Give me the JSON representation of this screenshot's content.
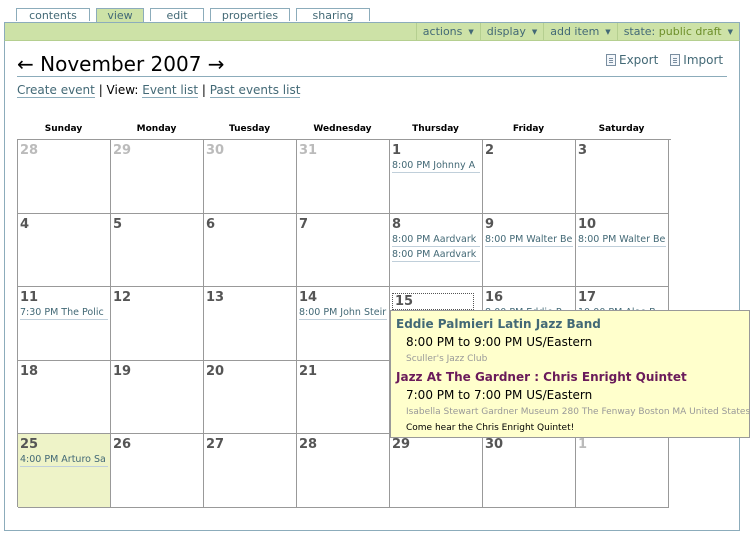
{
  "tabs": [
    {
      "label": "contents",
      "active": false
    },
    {
      "label": "view",
      "active": true
    },
    {
      "label": "edit",
      "active": false
    },
    {
      "label": "properties",
      "active": false
    },
    {
      "label": "sharing",
      "active": false
    }
  ],
  "menus": {
    "actions": "actions",
    "display": "display",
    "add_item": "add item",
    "state_label": "state:",
    "state_value": "public draft"
  },
  "header": {
    "prev_arrow": "←",
    "month": "November 2007",
    "next_arrow": "→",
    "export": "Export",
    "import": "Import"
  },
  "links": {
    "create_event": "Create event",
    "view_label": " | View: ",
    "event_list": "Event list",
    "sep": " | ",
    "past_events": "Past events list"
  },
  "weekdays": [
    "Sunday",
    "Monday",
    "Tuesday",
    "Wednesday",
    "Thursday",
    "Friday",
    "Saturday"
  ],
  "days": [
    {
      "num": "28",
      "other": true,
      "events": []
    },
    {
      "num": "29",
      "other": true,
      "events": []
    },
    {
      "num": "30",
      "other": true,
      "events": []
    },
    {
      "num": "31",
      "other": true,
      "events": []
    },
    {
      "num": "1",
      "events": [
        "8:00 PM Johnny A"
      ]
    },
    {
      "num": "2",
      "events": []
    },
    {
      "num": "3",
      "events": []
    },
    {
      "num": "4",
      "events": []
    },
    {
      "num": "5",
      "events": []
    },
    {
      "num": "6",
      "events": []
    },
    {
      "num": "7",
      "events": []
    },
    {
      "num": "8",
      "events": [
        "8:00 PM Aardvark",
        "8:00 PM Aardvark"
      ]
    },
    {
      "num": "9",
      "events": [
        "8:00 PM Walter Be"
      ]
    },
    {
      "num": "10",
      "events": [
        "8:00 PM Walter Be"
      ]
    },
    {
      "num": "11",
      "events": [
        "7:30 PM The Polic"
      ]
    },
    {
      "num": "12",
      "events": []
    },
    {
      "num": "13",
      "events": []
    },
    {
      "num": "14",
      "events": [
        "8:00 PM John Steir"
      ]
    },
    {
      "num": "15",
      "boxed": true,
      "events": [
        "8:00 PM Eddie P"
      ]
    },
    {
      "num": "16",
      "events": [
        "8:00 PM Eddie P"
      ]
    },
    {
      "num": "17",
      "events": [
        "10:00 PM Aloe B"
      ]
    },
    {
      "num": "18",
      "events": []
    },
    {
      "num": "19",
      "events": []
    },
    {
      "num": "20",
      "events": []
    },
    {
      "num": "21",
      "events": []
    },
    {
      "num": "22",
      "events": []
    },
    {
      "num": "23",
      "events": []
    },
    {
      "num": "24",
      "events": []
    },
    {
      "num": "25",
      "today": true,
      "events": [
        "4:00 PM Arturo Sa"
      ]
    },
    {
      "num": "26",
      "events": []
    },
    {
      "num": "27",
      "events": []
    },
    {
      "num": "28",
      "events": []
    },
    {
      "num": "29",
      "events": []
    },
    {
      "num": "30",
      "events": []
    },
    {
      "num": "1",
      "other": true,
      "events": []
    }
  ],
  "popup": {
    "event1_title": "Eddie Palmieri Latin Jazz Band",
    "event1_time": "8:00 PM to 9:00 PM US/Eastern",
    "event1_location": "Sculler's Jazz Club",
    "event2_title": "Jazz At The Gardner : Chris Enright Quintet",
    "event2_time": "7:00 PM to 7:00 PM US/Eastern",
    "event2_location": "Isabella Stewart Gardner Museum 280 The Fenway Boston MA United States",
    "event2_description": "Come hear the Chris Enright Quintet!"
  },
  "colors": {
    "accent_green": "#cde2a7",
    "border_blue": "#8cacbb",
    "link": "#436976",
    "popup_bg": "#ffffcc",
    "today_bg": "#eef3c8"
  }
}
